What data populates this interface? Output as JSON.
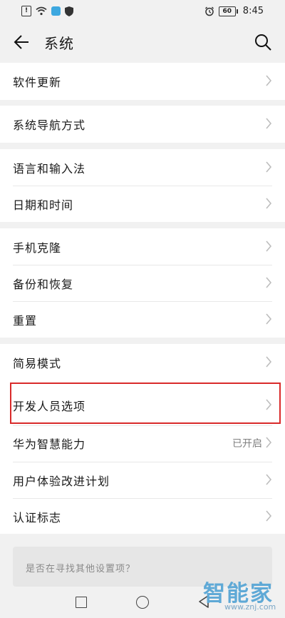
{
  "status_bar": {
    "battery": "60",
    "time": "8:45"
  },
  "header": {
    "title": "系统"
  },
  "rows": [
    {
      "label": "软件更新",
      "value": ""
    },
    {
      "label": "系统导航方式",
      "value": ""
    },
    {
      "label": "语言和输入法",
      "value": ""
    },
    {
      "label": "日期和时间",
      "value": ""
    },
    {
      "label": "手机克隆",
      "value": ""
    },
    {
      "label": "备份和恢复",
      "value": ""
    },
    {
      "label": "重置",
      "value": ""
    },
    {
      "label": "简易模式",
      "value": ""
    },
    {
      "label": "开发人员选项",
      "value": ""
    },
    {
      "label": "华为智慧能力",
      "value": "已开启"
    },
    {
      "label": "用户体验改进计划",
      "value": ""
    },
    {
      "label": "认证标志",
      "value": ""
    }
  ],
  "suggestion": {
    "text": "是否在寻找其他设置项？"
  },
  "watermark": {
    "brand": "智能家",
    "url": "www.znj.com"
  }
}
